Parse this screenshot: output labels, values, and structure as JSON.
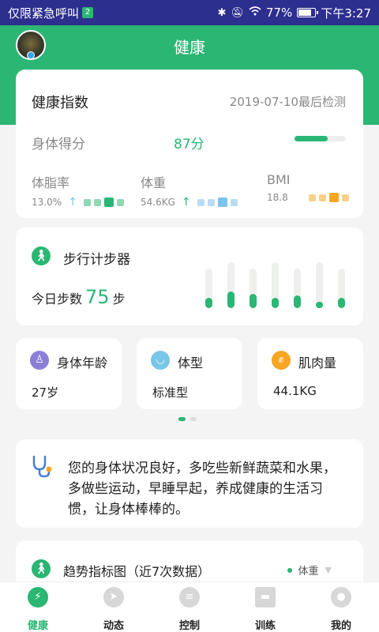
{
  "status_bar": {
    "carrier": "仅限紧急呼叫",
    "sim_badge": "2",
    "battery": "77%",
    "battery_level": 0.77,
    "time": "下午3:27"
  },
  "header": {
    "title": "健康"
  },
  "health_index": {
    "title": "健康指数",
    "date": "2019-07-10最后检测",
    "score_label": "身体得分",
    "score_value": "87分",
    "score_progress": 0.65,
    "metrics": [
      {
        "label": "体脂率",
        "value": "13.0%",
        "color": "#2bb673",
        "light": "#8fd8b4"
      },
      {
        "label": "体重",
        "value": "54.6KG",
        "color": "#2bb673",
        "light": "#b9dcf2",
        "accent": "#7cc3ec"
      },
      {
        "label": "BMI",
        "value": "18.8",
        "color": "#f5a623",
        "light": "#f7d08a"
      }
    ]
  },
  "pedometer": {
    "title": "步行计步器",
    "today_label": "今日步数",
    "today_value": "75",
    "today_unit": "步",
    "bars": [
      0.45,
      0.7,
      0.6,
      0.45,
      0.55,
      0.25,
      0.45
    ]
  },
  "small_cards": [
    {
      "title": "身体年龄",
      "value": "27岁",
      "icon": "person-icon",
      "color": "#8a7fd6"
    },
    {
      "title": "体型",
      "value": "标准型",
      "icon": "body-shape-icon",
      "color": "#79c7e8"
    },
    {
      "title": "肌肉量",
      "value": "44.1KG",
      "icon": "muscle-icon",
      "color": "#f5a623"
    }
  ],
  "tip": {
    "icon": "stethoscope-icon",
    "text": "您的身体状况良好，多吃些新鲜蔬菜和水果，多做些运动，早睡早起，养成健康的生活习惯，让身体棒棒的。"
  },
  "trend": {
    "title": "趋势指标图（近7次数据）",
    "selector": "体重"
  },
  "tabs": [
    {
      "label": "健康",
      "active": true
    },
    {
      "label": "动态"
    },
    {
      "label": "控制"
    },
    {
      "label": "训练"
    },
    {
      "label": "我的"
    }
  ]
}
